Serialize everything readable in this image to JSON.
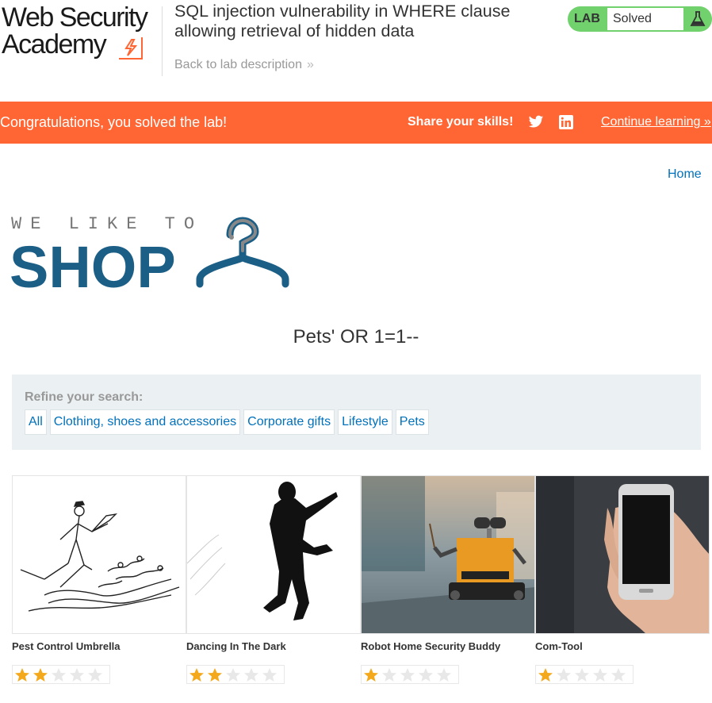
{
  "academy": {
    "logo_line1": "Web Security",
    "logo_line2": "Academy",
    "lab_title": "SQL injection vulnerability in WHERE clause allowing retrieval of hidden data",
    "back_link": "Back to lab description",
    "status_label": "LAB",
    "status_value": "Solved",
    "colors": {
      "accent": "#ff6633",
      "solved": "#70d16d",
      "link": "#0071bc"
    }
  },
  "banner": {
    "message": "Congratulations, you solved the lab!",
    "share": "Share your skills!",
    "continue": "Continue learning"
  },
  "shop": {
    "home": "Home",
    "logo_tag": "WE LIKE TO",
    "logo_big": "SHOP",
    "search_term": "Pets' OR 1=1--",
    "refine": "Refine your search:",
    "filters": [
      "All",
      "Clothing, shoes and accessories",
      "Corporate gifts",
      "Lifestyle",
      "Pets"
    ],
    "products": [
      {
        "name": "Pest Control Umbrella",
        "rating": 2,
        "icon": "umbrella-sketch-image"
      },
      {
        "name": "Dancing In The Dark",
        "rating": 2,
        "icon": "dancing-silhouette-image"
      },
      {
        "name": "Robot Home Security Buddy",
        "rating": 1,
        "icon": "robot-photo-image"
      },
      {
        "name": "Com-Tool",
        "rating": 1,
        "icon": "smartphone-photo-image"
      }
    ],
    "rating_max": 5
  }
}
